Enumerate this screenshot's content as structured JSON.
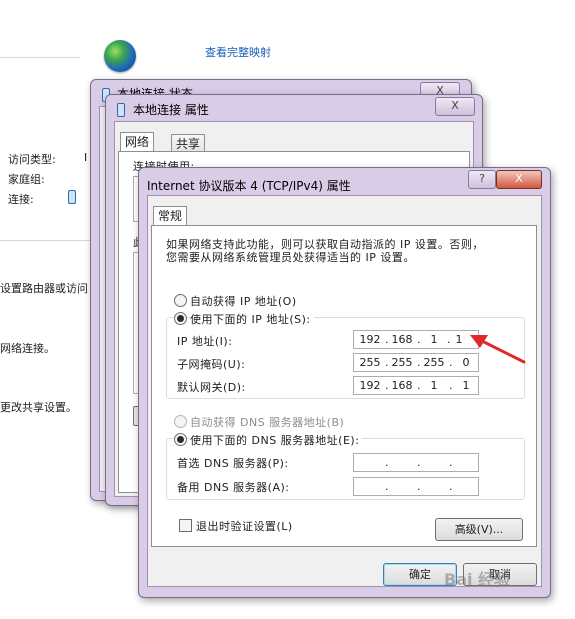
{
  "background": {
    "top_link": "查看完整映射",
    "labels": [
      "访问类型:",
      "家庭组:",
      "连接:"
    ],
    "side_texts": [
      "设置路由器或访问",
      "网络连接。",
      "更改共享设置。"
    ],
    "fragment_I": "I"
  },
  "status_window": {
    "title": "本地连接 状态"
  },
  "props_window": {
    "title": "本地连接 属性",
    "tab_network": "网络",
    "tab_share": "共享",
    "connect_using": "连接时使用:",
    "fragment_this": "此"
  },
  "ipv4_dialog": {
    "title": "Internet 协议版本 4 (TCP/IPv4) 属性",
    "help": "?",
    "close": "X",
    "tab": "常规",
    "description": [
      "如果网络支持此功能，则可以获取自动指派的 IP 设置。否则，",
      "您需要从网络系统管理员处获得适当的 IP 设置。"
    ],
    "auto_ip": "自动获得 IP 地址(O)",
    "manual_ip": "使用下面的 IP 地址(S):",
    "ip_label": "IP 地址(I):",
    "mask_label": "子网掩码(U):",
    "gateway_label": "默认网关(D):",
    "ip": [
      "192",
      "168",
      "1",
      "1"
    ],
    "mask": [
      "255",
      "255",
      "255",
      "0"
    ],
    "gateway": [
      "192",
      "168",
      "1",
      "1"
    ],
    "auto_dns": "自动获得 DNS 服务器地址(B)",
    "manual_dns": "使用下面的 DNS 服务器地址(E):",
    "pref_dns": "首选 DNS 服务器(P):",
    "alt_dns": "备用 DNS 服务器(A):",
    "validate": "退出时验证设置(L)",
    "advanced": "高级(V)...",
    "ok": "确定",
    "cancel": "取消"
  },
  "watermark": "Bai 经验"
}
